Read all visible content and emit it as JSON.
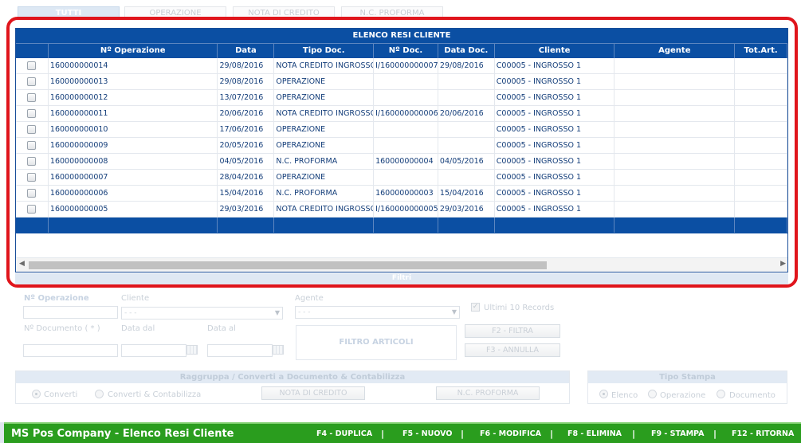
{
  "tabs": [
    {
      "label": "TUTTI",
      "active": true
    },
    {
      "label": "OPERAZIONE",
      "active": false
    },
    {
      "label": "NOTA DI CREDITO",
      "active": false
    },
    {
      "label": "N.C. PROFORMA",
      "active": false
    }
  ],
  "grid": {
    "title": "ELENCO RESI CLIENTE",
    "columns": [
      "Nº Operazione",
      "Data",
      "Tipo Doc.",
      "Nº Doc.",
      "Data Doc.",
      "Cliente",
      "Agente",
      "Tot.Art."
    ],
    "rows": [
      {
        "operazione": "160000000014",
        "data": "29/08/2016",
        "tipo": "NOTA CREDITO INGROSSO",
        "ndoc": "I/160000000007",
        "datadoc": "29/08/2016",
        "cliente": "C00005 - INGROSSO 1",
        "agente": "",
        "tot": ""
      },
      {
        "operazione": "160000000013",
        "data": "29/08/2016",
        "tipo": "OPERAZIONE",
        "ndoc": "",
        "datadoc": "",
        "cliente": "C00005 - INGROSSO 1",
        "agente": "",
        "tot": ""
      },
      {
        "operazione": "160000000012",
        "data": "13/07/2016",
        "tipo": "OPERAZIONE",
        "ndoc": "",
        "datadoc": "",
        "cliente": "C00005 - INGROSSO 1",
        "agente": "",
        "tot": ""
      },
      {
        "operazione": "160000000011",
        "data": "20/06/2016",
        "tipo": "NOTA CREDITO INGROSSO",
        "ndoc": "I/160000000006",
        "datadoc": "20/06/2016",
        "cliente": "C00005 - INGROSSO 1",
        "agente": "",
        "tot": ""
      },
      {
        "operazione": "160000000010",
        "data": "17/06/2016",
        "tipo": "OPERAZIONE",
        "ndoc": "",
        "datadoc": "",
        "cliente": "C00005 - INGROSSO 1",
        "agente": "",
        "tot": ""
      },
      {
        "operazione": "160000000009",
        "data": "20/05/2016",
        "tipo": "OPERAZIONE",
        "ndoc": "",
        "datadoc": "",
        "cliente": "C00005 - INGROSSO 1",
        "agente": "",
        "tot": ""
      },
      {
        "operazione": "160000000008",
        "data": "04/05/2016",
        "tipo": "N.C. PROFORMA",
        "ndoc": "160000000004",
        "datadoc": "04/05/2016",
        "cliente": "C00005 - INGROSSO 1",
        "agente": "",
        "tot": ""
      },
      {
        "operazione": "160000000007",
        "data": "28/04/2016",
        "tipo": "OPERAZIONE",
        "ndoc": "",
        "datadoc": "",
        "cliente": "C00005 - INGROSSO 1",
        "agente": "",
        "tot": ""
      },
      {
        "operazione": "160000000006",
        "data": "15/04/2016",
        "tipo": "N.C. PROFORMA",
        "ndoc": "160000000003",
        "datadoc": "15/04/2016",
        "cliente": "C00005 - INGROSSO 1",
        "agente": "",
        "tot": ""
      },
      {
        "operazione": "160000000005",
        "data": "29/03/2016",
        "tipo": "NOTA CREDITO INGROSSO",
        "ndoc": "I/160000000005",
        "datadoc": "29/03/2016",
        "cliente": "C00005 - INGROSSO 1",
        "agente": "",
        "tot": ""
      }
    ]
  },
  "filters": {
    "bar_label": "Filtri",
    "operazione_label": "Nº Operazione",
    "cliente_label": "Cliente",
    "cliente_value": "- - -",
    "agente_label": "Agente",
    "agente_value": "- - -",
    "ultimi_label": "Ultimi 10 Records",
    "ultimi_checked": true,
    "documento_label": "Nº Documento ( * )",
    "data_dal_label": "Data dal",
    "data_al_label": "Data al",
    "filtro_articoli": "FILTRO ARTICOLI",
    "filtra_button": "F2 - FILTRA",
    "annulla_button": "F3 - ANNULLA"
  },
  "raggruppa": {
    "title": "Raggruppa / Converti a Documento & Contabilizza",
    "converti": "Converti",
    "converti_contabilizza": "Converti & Contabilizza",
    "nota_button": "NOTA DI CREDITO",
    "proforma_button": "N.C. PROFORMA"
  },
  "stampa": {
    "title": "Tipo Stampa",
    "elenco": "Elenco",
    "operazione": "Operazione",
    "documento": "Documento"
  },
  "footer": {
    "title": "MS Pos Company - Elenco Resi Cliente",
    "keys": [
      "F4 - DUPLICA",
      "F5 - NUOVO",
      "F6 - MODIFICA",
      "F8 - ELIMINA",
      "F9 - STAMPA",
      "F12 - RITORNA"
    ],
    "background": "#2a9d1e"
  },
  "colors": {
    "accent": "#0b4fa3",
    "highlight": "#e0151c"
  }
}
